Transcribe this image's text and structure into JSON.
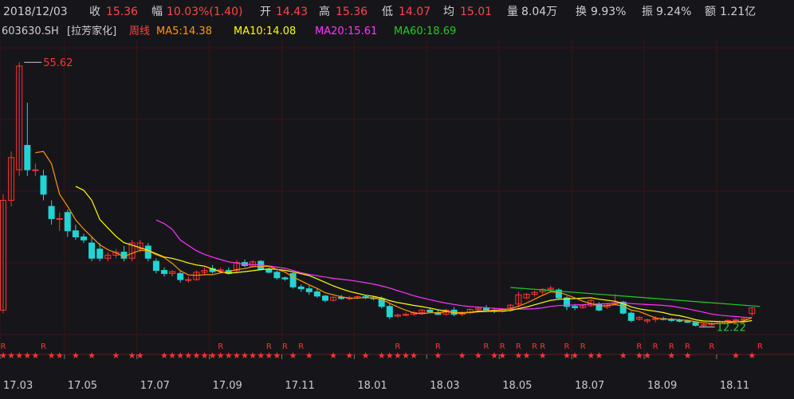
{
  "header": {
    "date": "2018/12/03",
    "close_label": "收",
    "close_value": "15.36",
    "change_label": "幅",
    "change_value": "10.03%(1.40)",
    "open_label": "开",
    "open_value": "14.43",
    "high_label": "高",
    "high_value": "15.36",
    "low_label": "低",
    "low_value": "14.07",
    "avg_label": "均",
    "avg_value": "15.01",
    "volume_label": "量",
    "volume_value": "8.04万",
    "turnover_label": "换",
    "turnover_value": "9.93%",
    "amplitude_label": "振",
    "amplitude_value": "9.24%",
    "amount_label": "额",
    "amount_value": "1.21亿"
  },
  "ma_bar": {
    "code": "603630.SH",
    "name": "[拉芳家化]",
    "period": "周线",
    "ma5": "MA5:14.38",
    "ma10": "MA10:14.08",
    "ma20": "MA20:15.61",
    "ma60": "MA60:18.69"
  },
  "colors": {
    "up": "#ff3333",
    "down": "#22d4d4",
    "ma5": "#ff9900",
    "ma10": "#ffff00",
    "ma20": "#ff33ff",
    "ma60": "#22cc22",
    "grid": "#3a1414",
    "background": "#16161a"
  },
  "chart_data": {
    "type": "candlestick",
    "ylim": [
      11.0,
      58.0
    ],
    "x_ticks": [
      "17.03",
      "17.05",
      "17.07",
      "17.09",
      "17.11",
      "18.01",
      "18.03",
      "18.05",
      "18.07",
      "18.09",
      "18.11"
    ],
    "x_tick_index": [
      0,
      8,
      17,
      26,
      35,
      44,
      53,
      62,
      71,
      80,
      89
    ],
    "high_annotation": {
      "index": 2,
      "value": "55.62"
    },
    "low_annotation": {
      "index": 87,
      "value": "12.22"
    },
    "candles": [
      {
        "o": 15.0,
        "h": 34.0,
        "l": 14.5,
        "c": 33.0
      },
      {
        "o": 33.0,
        "h": 41.0,
        "l": 32.0,
        "c": 40.0
      },
      {
        "o": 38.0,
        "h": 55.62,
        "l": 37.0,
        "c": 55.0
      },
      {
        "o": 42.0,
        "h": 49.0,
        "l": 37.0,
        "c": 38.0
      },
      {
        "o": 38.0,
        "h": 39.0,
        "l": 37.0,
        "c": 38.0
      },
      {
        "o": 37.0,
        "h": 38.0,
        "l": 33.0,
        "c": 34.0
      },
      {
        "o": 32.0,
        "h": 33.0,
        "l": 29.0,
        "c": 30.0
      },
      {
        "o": 30.0,
        "h": 31.0,
        "l": 28.0,
        "c": 30.0
      },
      {
        "o": 31.0,
        "h": 31.5,
        "l": 27.0,
        "c": 28.0
      },
      {
        "o": 28.0,
        "h": 29.0,
        "l": 26.5,
        "c": 27.0
      },
      {
        "o": 27.0,
        "h": 27.5,
        "l": 26.0,
        "c": 26.5
      },
      {
        "o": 26.0,
        "h": 27.0,
        "l": 23.0,
        "c": 23.5
      },
      {
        "o": 25.0,
        "h": 26.0,
        "l": 23.0,
        "c": 23.5
      },
      {
        "o": 23.5,
        "h": 24.5,
        "l": 23.0,
        "c": 24.0
      },
      {
        "o": 24.0,
        "h": 25.0,
        "l": 23.5,
        "c": 24.5
      },
      {
        "o": 24.5,
        "h": 25.5,
        "l": 23.0,
        "c": 23.5
      },
      {
        "o": 23.5,
        "h": 26.5,
        "l": 23.0,
        "c": 26.0
      },
      {
        "o": 25.0,
        "h": 26.5,
        "l": 24.5,
        "c": 26.0
      },
      {
        "o": 25.5,
        "h": 26.0,
        "l": 23.0,
        "c": 23.5
      },
      {
        "o": 23.0,
        "h": 23.5,
        "l": 21.0,
        "c": 21.5
      },
      {
        "o": 21.5,
        "h": 22.0,
        "l": 20.5,
        "c": 21.0
      },
      {
        "o": 21.0,
        "h": 21.5,
        "l": 20.5,
        "c": 21.3
      },
      {
        "o": 21.0,
        "h": 21.5,
        "l": 19.5,
        "c": 20.0
      },
      {
        "o": 20.0,
        "h": 20.5,
        "l": 19.5,
        "c": 20.0
      },
      {
        "o": 20.0,
        "h": 21.5,
        "l": 19.8,
        "c": 21.2
      },
      {
        "o": 21.2,
        "h": 22.0,
        "l": 20.8,
        "c": 21.5
      },
      {
        "o": 21.8,
        "h": 22.4,
        "l": 21.0,
        "c": 21.3
      },
      {
        "o": 21.5,
        "h": 22.0,
        "l": 21.0,
        "c": 21.6
      },
      {
        "o": 21.5,
        "h": 22.0,
        "l": 20.8,
        "c": 21.0
      },
      {
        "o": 21.5,
        "h": 23.2,
        "l": 21.0,
        "c": 22.8
      },
      {
        "o": 22.8,
        "h": 23.3,
        "l": 22.0,
        "c": 22.3
      },
      {
        "o": 22.2,
        "h": 23.2,
        "l": 22.0,
        "c": 22.9
      },
      {
        "o": 23.0,
        "h": 23.2,
        "l": 21.5,
        "c": 21.7
      },
      {
        "o": 21.7,
        "h": 22.0,
        "l": 21.0,
        "c": 21.2
      },
      {
        "o": 21.2,
        "h": 21.5,
        "l": 20.0,
        "c": 20.3
      },
      {
        "o": 20.3,
        "h": 20.5,
        "l": 19.8,
        "c": 20.1
      },
      {
        "o": 21.0,
        "h": 21.2,
        "l": 18.5,
        "c": 18.8
      },
      {
        "o": 18.8,
        "h": 19.2,
        "l": 18.0,
        "c": 18.5
      },
      {
        "o": 18.5,
        "h": 19.0,
        "l": 17.5,
        "c": 18.0
      },
      {
        "o": 18.0,
        "h": 18.5,
        "l": 17.0,
        "c": 17.3
      },
      {
        "o": 17.3,
        "h": 17.5,
        "l": 16.3,
        "c": 16.6
      },
      {
        "o": 16.6,
        "h": 17.3,
        "l": 16.4,
        "c": 17.1
      },
      {
        "o": 17.1,
        "h": 17.5,
        "l": 16.7,
        "c": 16.9
      },
      {
        "o": 16.9,
        "h": 17.3,
        "l": 16.6,
        "c": 17.0
      },
      {
        "o": 17.0,
        "h": 17.4,
        "l": 16.8,
        "c": 17.2
      },
      {
        "o": 17.2,
        "h": 17.5,
        "l": 16.8,
        "c": 17.0
      },
      {
        "o": 17.0,
        "h": 17.3,
        "l": 16.6,
        "c": 16.9
      },
      {
        "o": 16.9,
        "h": 17.2,
        "l": 15.3,
        "c": 15.6
      },
      {
        "o": 15.6,
        "h": 16.0,
        "l": 13.5,
        "c": 13.9
      },
      {
        "o": 14.0,
        "h": 14.4,
        "l": 13.8,
        "c": 14.2
      },
      {
        "o": 14.2,
        "h": 14.6,
        "l": 14.0,
        "c": 14.3
      },
      {
        "o": 14.3,
        "h": 14.8,
        "l": 14.1,
        "c": 14.6
      },
      {
        "o": 14.6,
        "h": 15.2,
        "l": 14.3,
        "c": 15.0
      },
      {
        "o": 15.0,
        "h": 15.4,
        "l": 14.5,
        "c": 14.7
      },
      {
        "o": 14.6,
        "h": 15.0,
        "l": 14.2,
        "c": 14.3
      },
      {
        "o": 14.3,
        "h": 15.2,
        "l": 14.1,
        "c": 15.0
      },
      {
        "o": 15.0,
        "h": 15.5,
        "l": 14.0,
        "c": 14.3
      },
      {
        "o": 14.3,
        "h": 14.8,
        "l": 14.0,
        "c": 14.6
      },
      {
        "o": 14.6,
        "h": 15.3,
        "l": 14.3,
        "c": 15.1
      },
      {
        "o": 15.1,
        "h": 15.6,
        "l": 14.7,
        "c": 15.3
      },
      {
        "o": 15.3,
        "h": 15.8,
        "l": 14.8,
        "c": 15.0
      },
      {
        "o": 15.0,
        "h": 15.4,
        "l": 14.5,
        "c": 14.8
      },
      {
        "o": 14.8,
        "h": 15.3,
        "l": 14.6,
        "c": 15.1
      },
      {
        "o": 15.4,
        "h": 16.0,
        "l": 15.0,
        "c": 15.8
      },
      {
        "o": 16.0,
        "h": 18.0,
        "l": 15.5,
        "c": 17.5
      },
      {
        "o": 17.0,
        "h": 17.8,
        "l": 16.8,
        "c": 17.6
      },
      {
        "o": 17.6,
        "h": 18.2,
        "l": 17.2,
        "c": 17.9
      },
      {
        "o": 18.0,
        "h": 18.6,
        "l": 17.6,
        "c": 18.4
      },
      {
        "o": 18.4,
        "h": 19.0,
        "l": 18.0,
        "c": 18.6
      },
      {
        "o": 18.3,
        "h": 18.6,
        "l": 16.8,
        "c": 17.0
      },
      {
        "o": 17.0,
        "h": 17.3,
        "l": 15.0,
        "c": 15.6
      },
      {
        "o": 15.6,
        "h": 16.0,
        "l": 15.0,
        "c": 15.4
      },
      {
        "o": 15.4,
        "h": 15.9,
        "l": 15.2,
        "c": 15.7
      },
      {
        "o": 15.7,
        "h": 16.8,
        "l": 15.5,
        "c": 16.6
      },
      {
        "o": 16.0,
        "h": 16.3,
        "l": 14.8,
        "c": 15.0
      },
      {
        "o": 15.5,
        "h": 16.2,
        "l": 15.2,
        "c": 16.0
      },
      {
        "o": 16.0,
        "h": 17.6,
        "l": 15.8,
        "c": 16.2
      },
      {
        "o": 16.3,
        "h": 16.5,
        "l": 14.3,
        "c": 14.5
      },
      {
        "o": 14.5,
        "h": 14.8,
        "l": 13.0,
        "c": 13.3
      },
      {
        "o": 13.5,
        "h": 14.0,
        "l": 13.3,
        "c": 13.8
      },
      {
        "o": 13.2,
        "h": 13.6,
        "l": 12.8,
        "c": 13.4
      },
      {
        "o": 13.5,
        "h": 14.0,
        "l": 13.0,
        "c": 13.6
      },
      {
        "o": 13.6,
        "h": 13.9,
        "l": 13.3,
        "c": 13.5
      },
      {
        "o": 13.5,
        "h": 13.7,
        "l": 13.1,
        "c": 13.3
      },
      {
        "o": 13.3,
        "h": 13.6,
        "l": 13.0,
        "c": 13.2
      },
      {
        "o": 13.2,
        "h": 13.4,
        "l": 12.9,
        "c": 13.0
      },
      {
        "o": 13.0,
        "h": 13.1,
        "l": 12.3,
        "c": 12.5
      },
      {
        "o": 12.5,
        "h": 12.9,
        "l": 12.22,
        "c": 12.6
      },
      {
        "o": 12.6,
        "h": 13.0,
        "l": 12.4,
        "c": 12.8
      },
      {
        "o": 12.8,
        "h": 13.3,
        "l": 12.7,
        "c": 13.1
      },
      {
        "o": 13.1,
        "h": 13.5,
        "l": 12.8,
        "c": 13.3
      },
      {
        "o": 13.3,
        "h": 13.6,
        "l": 13.0,
        "c": 13.4
      },
      {
        "o": 13.4,
        "h": 13.8,
        "l": 13.2,
        "c": 13.6
      },
      {
        "o": 14.43,
        "h": 15.36,
        "l": 14.07,
        "c": 15.36
      }
    ],
    "ma60_line": [
      [
        63,
        18.7
      ],
      [
        94,
        15.6
      ]
    ],
    "markers": [
      {
        "type": "R",
        "indices": [
          0,
          5,
          27,
          33,
          35,
          37,
          49,
          54,
          60,
          62,
          64,
          66,
          67,
          70,
          72,
          79,
          81,
          83,
          85,
          88,
          94
        ]
      },
      {
        "type": "★",
        "indices": [
          0,
          1,
          2,
          3,
          4,
          6,
          7,
          9,
          11,
          14,
          16,
          17,
          20,
          21,
          22,
          23,
          24,
          25,
          26,
          27,
          28,
          29,
          30,
          31,
          32,
          33,
          34,
          36,
          38,
          41,
          43,
          45,
          47,
          48,
          49,
          50,
          51,
          54,
          57,
          59,
          61,
          62,
          64,
          65,
          67,
          70,
          71,
          73,
          74,
          77,
          79,
          80,
          83,
          85,
          91,
          93
        ]
      }
    ]
  }
}
